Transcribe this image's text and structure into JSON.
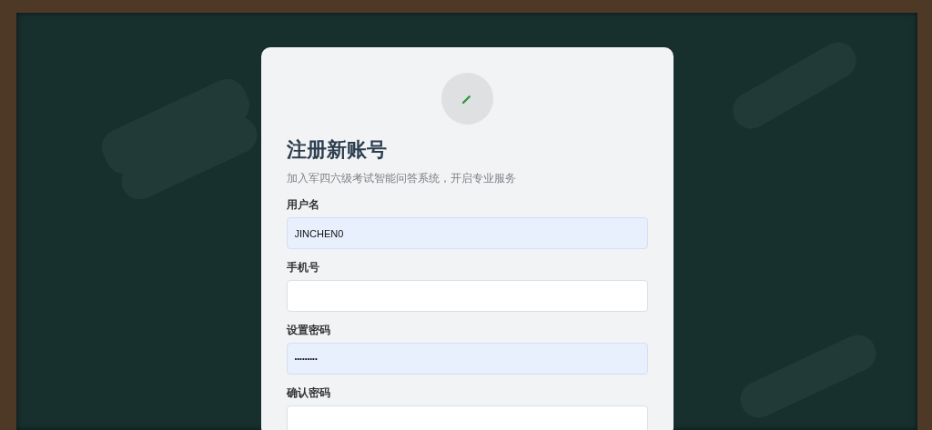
{
  "card": {
    "title": "注册新账号",
    "subtitle": "加入军四六级考试智能问答系统，开启专业服务"
  },
  "fields": [
    {
      "label": "用户名",
      "kind": "text",
      "value": "JINCHEN0",
      "autofilled": true
    },
    {
      "label": "手机号",
      "kind": "text",
      "autofilled": false
    },
    {
      "label": "设置密码",
      "kind": "password",
      "value": "•••••••••",
      "autofilled": true
    },
    {
      "label": "确认密码",
      "kind": "password",
      "autofilled": false
    }
  ]
}
